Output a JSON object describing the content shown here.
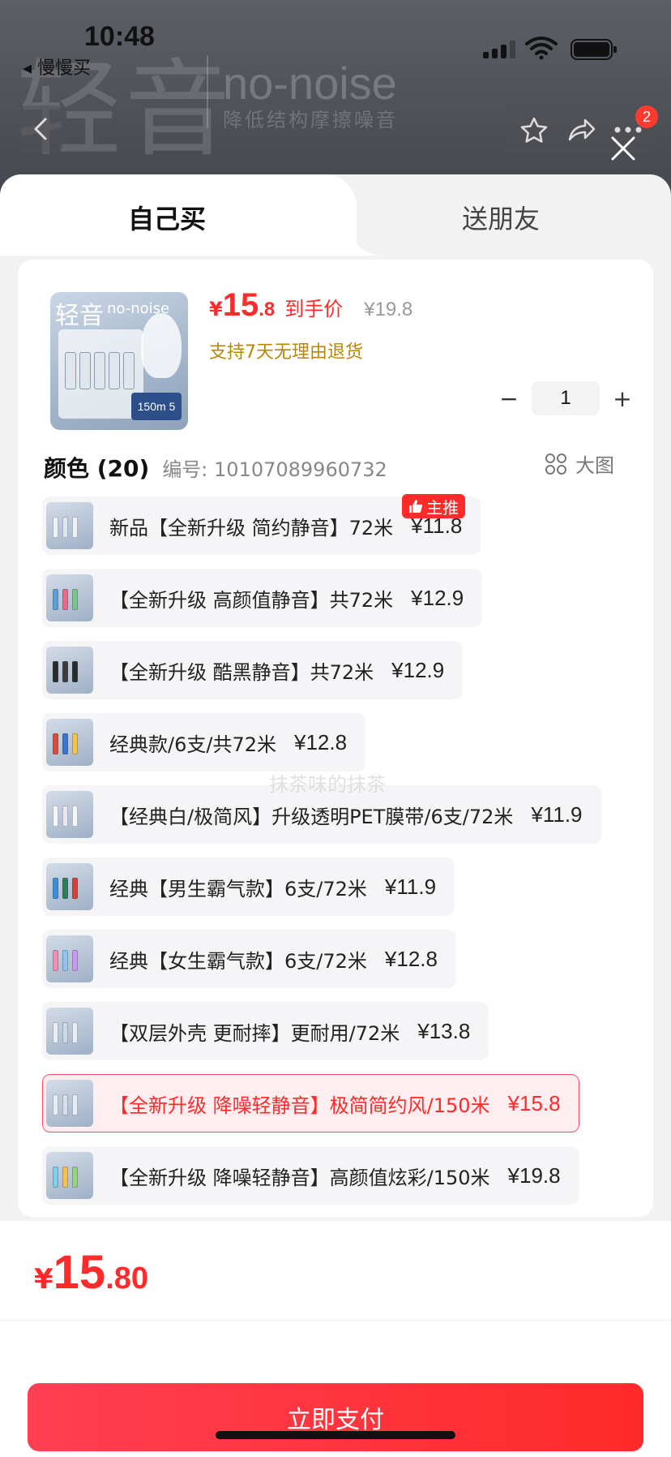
{
  "status_bar": {
    "time": "10:48",
    "back_app": "◂ 慢慢买"
  },
  "banner": {
    "title": "轻音",
    "brand": "no-noise",
    "subtitle": "降低结构摩擦噪音"
  },
  "cart_badge": "2",
  "tabs": {
    "self": "自己买",
    "friend": "送朋友"
  },
  "product": {
    "thumb_title": "轻音",
    "thumb_brand": "no-noise",
    "thumb_spec": "150m 5",
    "price_currency": "¥",
    "price_int": "15",
    "price_dec": ".8",
    "price_label": "到手价",
    "original_price": "¥19.8",
    "return_policy": "支持7天无理由退货",
    "quantity": "1",
    "minus": "−",
    "plus": "+"
  },
  "color_section": {
    "heading": "颜色 (20)",
    "code": "编号: 10107089960732",
    "big_view": "大图",
    "recommend_badge": "主推"
  },
  "options": [
    {
      "label": "新品【全新升级 简约静音】72米",
      "price": "¥11.8",
      "selected": false
    },
    {
      "label": "【全新升级 高颜值静音】共72米",
      "price": "¥12.9",
      "selected": false
    },
    {
      "label": "【全新升级 酷黑静音】共72米",
      "price": "¥12.9",
      "selected": false
    },
    {
      "label": "经典款/6支/共72米",
      "price": "¥12.8",
      "selected": false
    },
    {
      "label": "【经典白/极简风】升级透明PET膜带/6支/72米",
      "price": "¥11.9",
      "selected": false
    },
    {
      "label": "经典【男生霸气款】6支/72米",
      "price": "¥11.9",
      "selected": false
    },
    {
      "label": "经典【女生霸气款】6支/72米",
      "price": "¥12.8",
      "selected": false
    },
    {
      "label": "【双层外壳 更耐摔】更耐用/72米",
      "price": "¥13.8",
      "selected": false
    },
    {
      "label": "【全新升级 降噪轻静音】极简简约风/150米",
      "price": "¥15.8",
      "selected": true
    },
    {
      "label": "【全新升级 降噪轻静音】高颜值炫彩/150米",
      "price": "¥19.8",
      "selected": false
    }
  ],
  "watermark": "抹茶味的抹茶",
  "footer": {
    "total_currency": "¥",
    "total_int": "15",
    "total_dec": ".80",
    "pay_label": "立即支付"
  },
  "colors": {
    "accent": "#ff2a2a",
    "selected_bg": "#ffeef0",
    "policy": "#b8860b"
  }
}
